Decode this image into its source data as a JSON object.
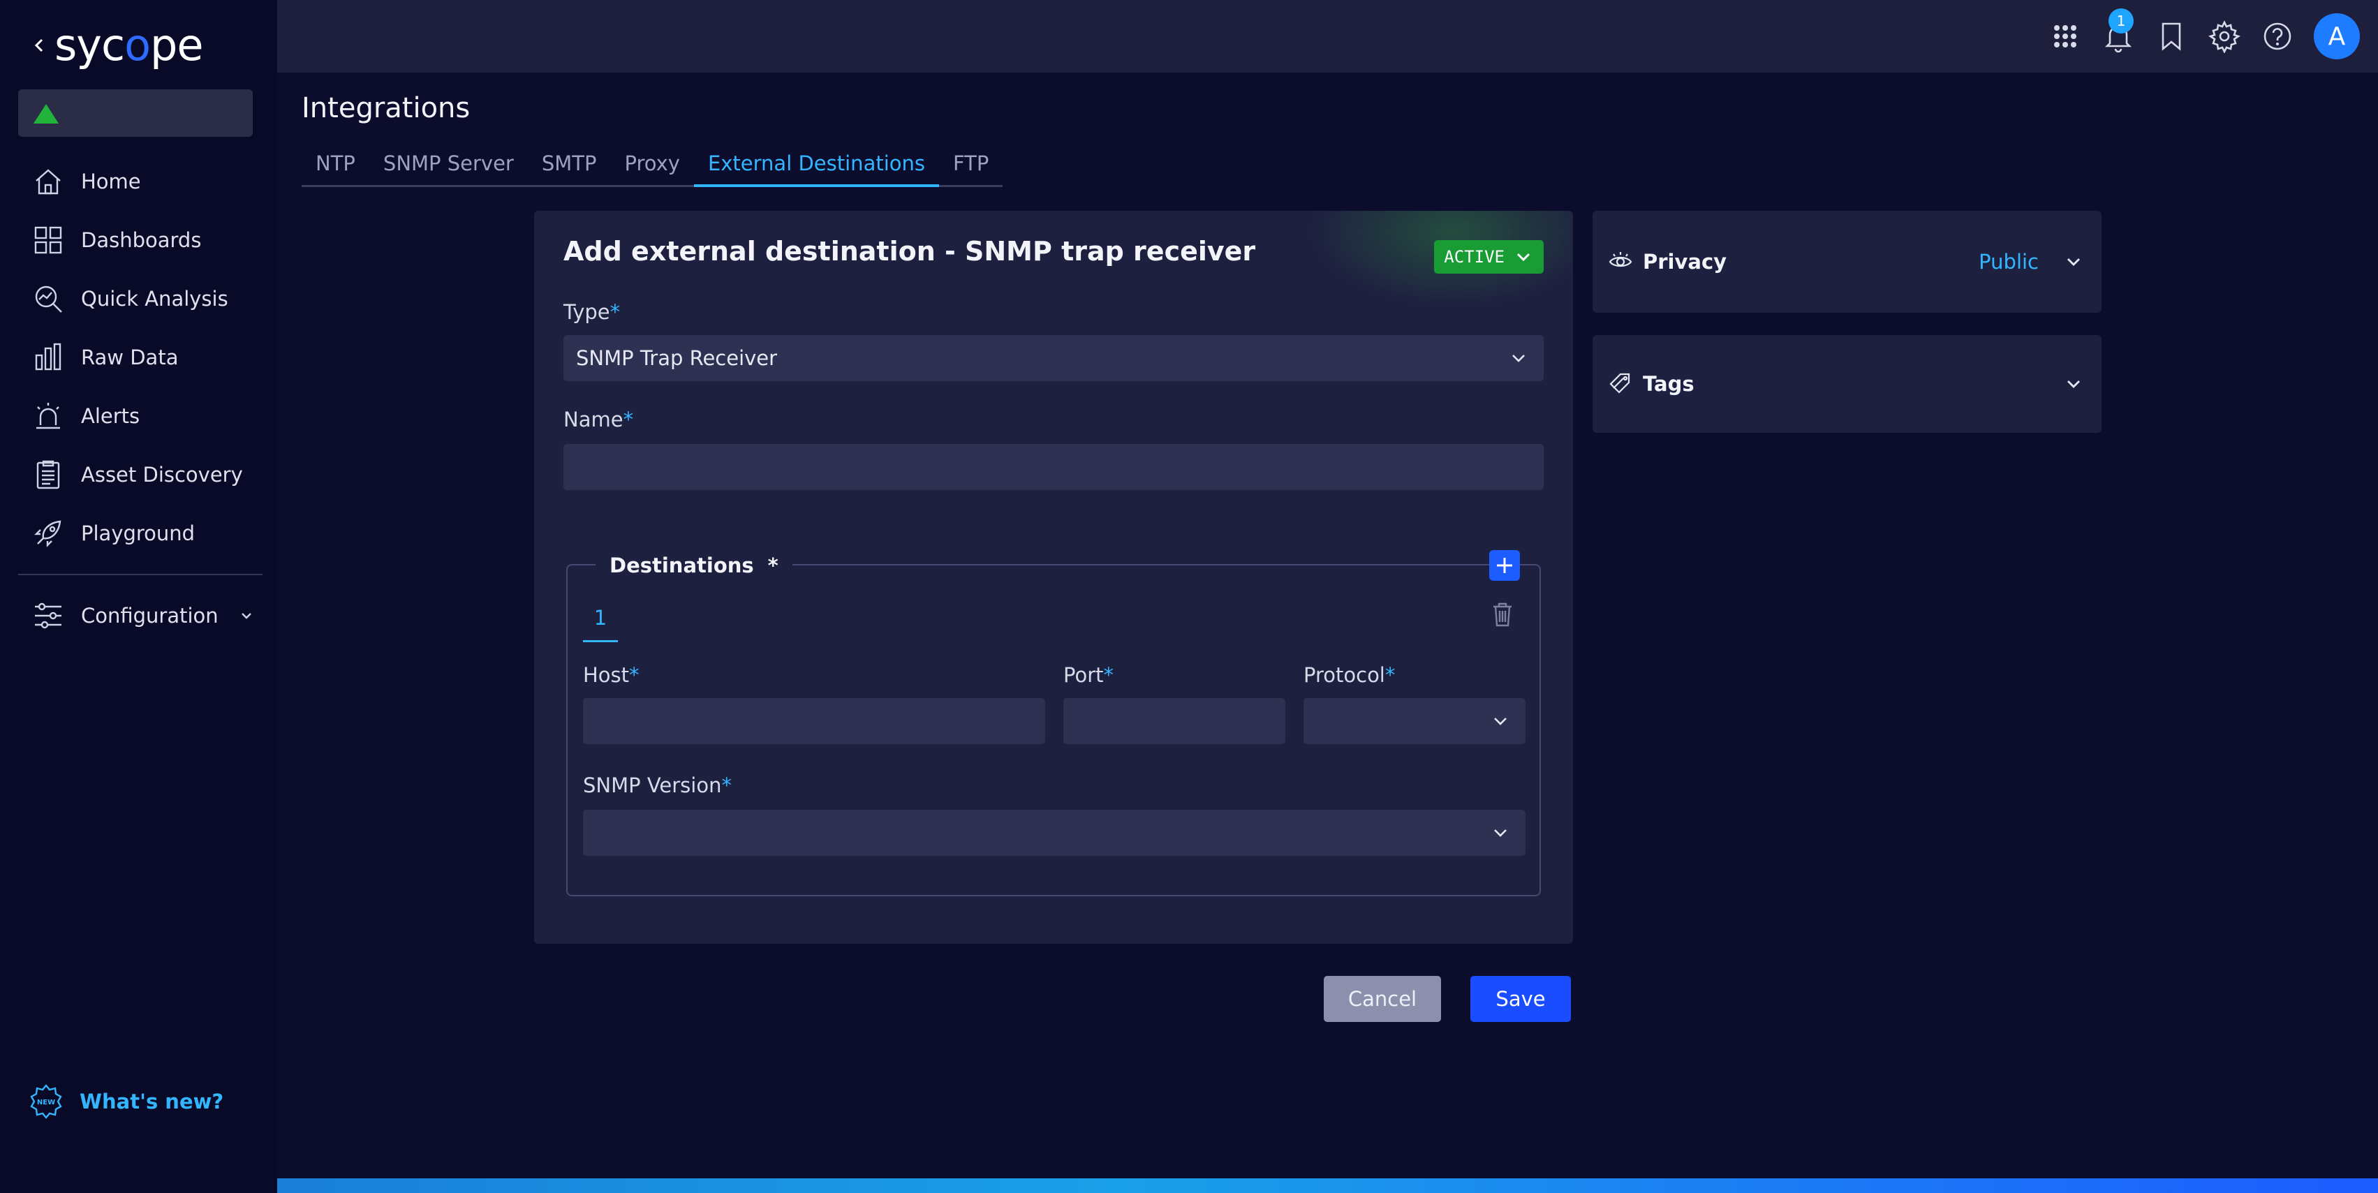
{
  "brand": {
    "logo_prefix": "syc",
    "logo_mark": "o",
    "logo_suffix": "pe"
  },
  "sidebar": {
    "items": [
      {
        "label": "Home",
        "icon": "home-icon"
      },
      {
        "label": "Dashboards",
        "icon": "dashboards-icon"
      },
      {
        "label": "Quick Analysis",
        "icon": "quick-analysis-icon"
      },
      {
        "label": "Raw Data",
        "icon": "raw-data-icon"
      },
      {
        "label": "Alerts",
        "icon": "alerts-icon"
      },
      {
        "label": "Asset Discovery",
        "icon": "asset-discovery-icon"
      },
      {
        "label": "Playground",
        "icon": "playground-icon"
      }
    ],
    "configuration_label": "Configuration",
    "whats_new_label": "What's new?"
  },
  "topbar": {
    "notification_count": "1",
    "avatar_initial": "A"
  },
  "page": {
    "title": "Integrations",
    "tabs": [
      "NTP",
      "SNMP Server",
      "SMTP",
      "Proxy",
      "External Destinations",
      "FTP"
    ],
    "active_tab": "External Destinations"
  },
  "form": {
    "title": "Add external destination - SNMP trap receiver",
    "status_badge": "ACTIVE",
    "type_label": "Type",
    "type_value": "SNMP Trap Receiver",
    "name_label": "Name",
    "name_value": "",
    "required_mark": "*",
    "destinations": {
      "legend": "Destinations",
      "required_mark": "*",
      "tabs": [
        "1"
      ],
      "host_label": "Host",
      "host_value": "",
      "port_label": "Port",
      "port_value": "",
      "protocol_label": "Protocol",
      "protocol_value": "",
      "snmp_version_label": "SNMP Version",
      "snmp_version_value": ""
    },
    "cancel_label": "Cancel",
    "save_label": "Save"
  },
  "panels": {
    "privacy_label": "Privacy",
    "privacy_value": "Public",
    "tags_label": "Tags"
  },
  "colors": {
    "accent": "#33b6ff",
    "primary_button": "#1a4dff",
    "active_badge": "#1a9c35",
    "background": "#0c0d2d",
    "card": "#1e2040",
    "field": "#2f3152"
  }
}
